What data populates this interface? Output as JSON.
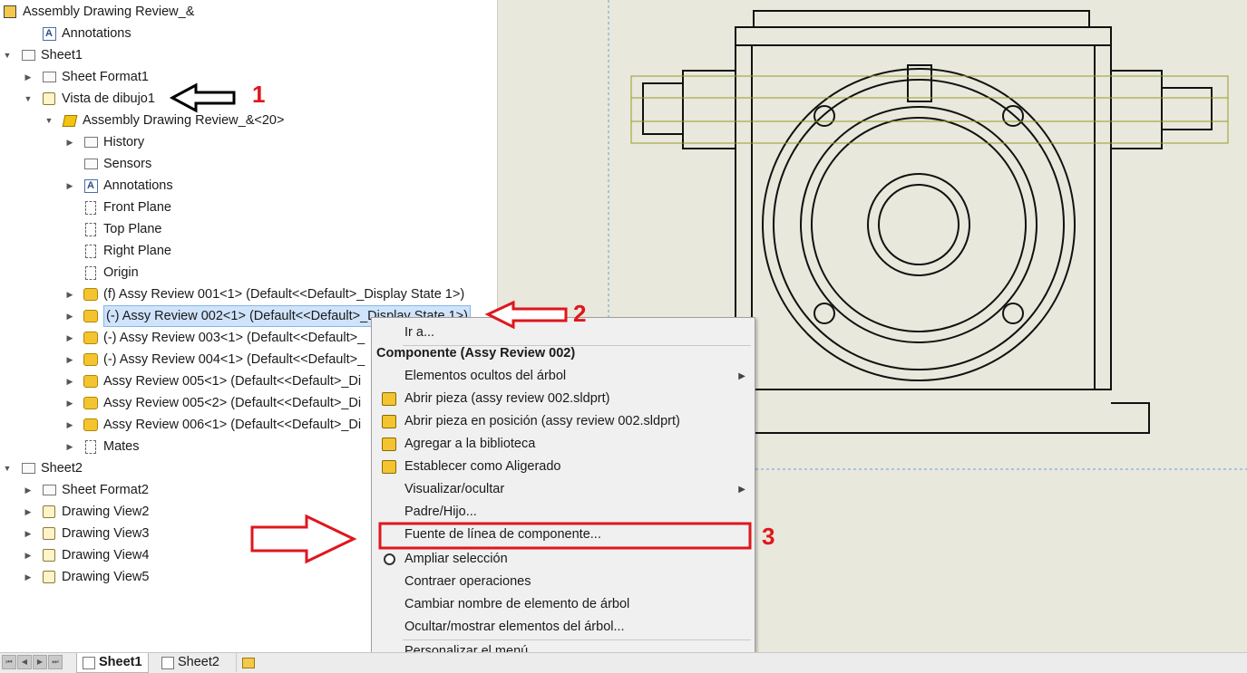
{
  "tree": {
    "root_label": "Assembly Drawing Review_&",
    "items": [
      {
        "label": "Annotations",
        "indent": 1,
        "expander": "",
        "icon": "annotations-icon"
      },
      {
        "label": "Sheet1",
        "indent": 0,
        "expander": "▼",
        "icon": "sheet-icon"
      },
      {
        "label": "Sheet Format1",
        "indent": 1,
        "expander": "▶",
        "icon": "sheet-format-icon"
      },
      {
        "label": "Vista de dibujo1",
        "indent": 1,
        "expander": "▼",
        "icon": "drawing-view-icon"
      },
      {
        "label": "Assembly Drawing Review_&<20>",
        "indent": 2,
        "expander": "▼",
        "icon": "assembly-icon"
      },
      {
        "label": "History",
        "indent": 3,
        "expander": "▶",
        "icon": "history-icon"
      },
      {
        "label": "Sensors",
        "indent": 3,
        "expander": "",
        "icon": "sensors-icon"
      },
      {
        "label": "Annotations",
        "indent": 3,
        "expander": "▶",
        "icon": "annotations-icon"
      },
      {
        "label": "Front Plane",
        "indent": 3,
        "expander": "",
        "icon": "plane-icon"
      },
      {
        "label": "Top Plane",
        "indent": 3,
        "expander": "",
        "icon": "plane-icon"
      },
      {
        "label": "Right Plane",
        "indent": 3,
        "expander": "",
        "icon": "plane-icon"
      },
      {
        "label": "Origin",
        "indent": 3,
        "expander": "",
        "icon": "origin-icon"
      },
      {
        "label": "(f) Assy Review 001<1> (Default<<Default>_Display State 1>)",
        "indent": 3,
        "expander": "▶",
        "icon": "part-icon"
      },
      {
        "label": "(-) Assy Review 002<1> (Default<<Default>_Display State 1>)",
        "indent": 3,
        "expander": "▶",
        "icon": "part-icon",
        "selected": true
      },
      {
        "label": "(-) Assy Review 003<1> (Default<<Default>_",
        "indent": 3,
        "expander": "▶",
        "icon": "part-icon"
      },
      {
        "label": "(-) Assy Review 004<1> (Default<<Default>_",
        "indent": 3,
        "expander": "▶",
        "icon": "part-icon"
      },
      {
        "label": "Assy Review 005<1> (Default<<Default>_Di",
        "indent": 3,
        "expander": "▶",
        "icon": "part-icon"
      },
      {
        "label": "Assy Review 005<2> (Default<<Default>_Di",
        "indent": 3,
        "expander": "▶",
        "icon": "part-icon"
      },
      {
        "label": "Assy Review 006<1> (Default<<Default>_Di",
        "indent": 3,
        "expander": "▶",
        "icon": "part-icon"
      },
      {
        "label": "Mates",
        "indent": 3,
        "expander": "▶",
        "icon": "mates-icon"
      },
      {
        "label": "Sheet2",
        "indent": 0,
        "expander": "▼",
        "icon": "sheet-icon"
      },
      {
        "label": "Sheet Format2",
        "indent": 1,
        "expander": "▶",
        "icon": "sheet-format-icon"
      },
      {
        "label": "Drawing View2",
        "indent": 1,
        "expander": "▶",
        "icon": "drawing-view-icon"
      },
      {
        "label": "Drawing View3",
        "indent": 1,
        "expander": "▶",
        "icon": "drawing-view-icon"
      },
      {
        "label": "Drawing View4",
        "indent": 1,
        "expander": "▶",
        "icon": "drawing-view-icon"
      },
      {
        "label": "Drawing View5",
        "indent": 1,
        "expander": "▶",
        "icon": "drawing-view-icon"
      }
    ]
  },
  "context_menu": {
    "items": [
      {
        "label": "Ir a...",
        "type": "item",
        "icon": ""
      },
      {
        "label": "Componente (Assy Review 002)",
        "type": "header",
        "icon": ""
      },
      {
        "label": "Elementos ocultos del árbol",
        "type": "submenu",
        "icon": ""
      },
      {
        "label": "Abrir pieza (assy review 002.sldprt)",
        "type": "item",
        "icon": "open-part-icon"
      },
      {
        "label": "Abrir pieza en posición (assy review 002.sldprt)",
        "type": "item",
        "icon": "open-part-in-context-icon"
      },
      {
        "label": "Agregar a la biblioteca",
        "type": "item",
        "icon": "add-to-library-icon"
      },
      {
        "label": "Establecer como Aligerado",
        "type": "item",
        "icon": "lightweight-icon"
      },
      {
        "label": "Visualizar/ocultar",
        "type": "submenu",
        "icon": ""
      },
      {
        "label": "Padre/Hijo...",
        "type": "item",
        "icon": ""
      },
      {
        "label": "Fuente de línea de componente...",
        "type": "item",
        "icon": "",
        "highlighted": true
      },
      {
        "label": "Ampliar selección",
        "type": "item",
        "icon": "zoom-selection-icon"
      },
      {
        "label": "Contraer operaciones",
        "type": "item",
        "icon": ""
      },
      {
        "label": "Cambiar nombre de elemento de árbol",
        "type": "item",
        "icon": ""
      },
      {
        "label": "Ocultar/mostrar elementos del árbol...",
        "type": "item",
        "icon": ""
      },
      {
        "label": "Personalizar el menú",
        "type": "item",
        "icon": ""
      }
    ]
  },
  "annotations": {
    "step1": "1",
    "step2": "2",
    "step3": "3",
    "arrow_black_color": "#000000",
    "arrow_red_color": "#e0161e"
  },
  "tabs": {
    "sheet1": "Sheet1",
    "sheet2": "Sheet2",
    "active": "Sheet1"
  },
  "colors": {
    "canvas_bg": "#e8e8dc",
    "selection_bg": "#cfe3fa",
    "highlight_box": "#e0161e",
    "highlight_line": "#9a9a2a"
  }
}
